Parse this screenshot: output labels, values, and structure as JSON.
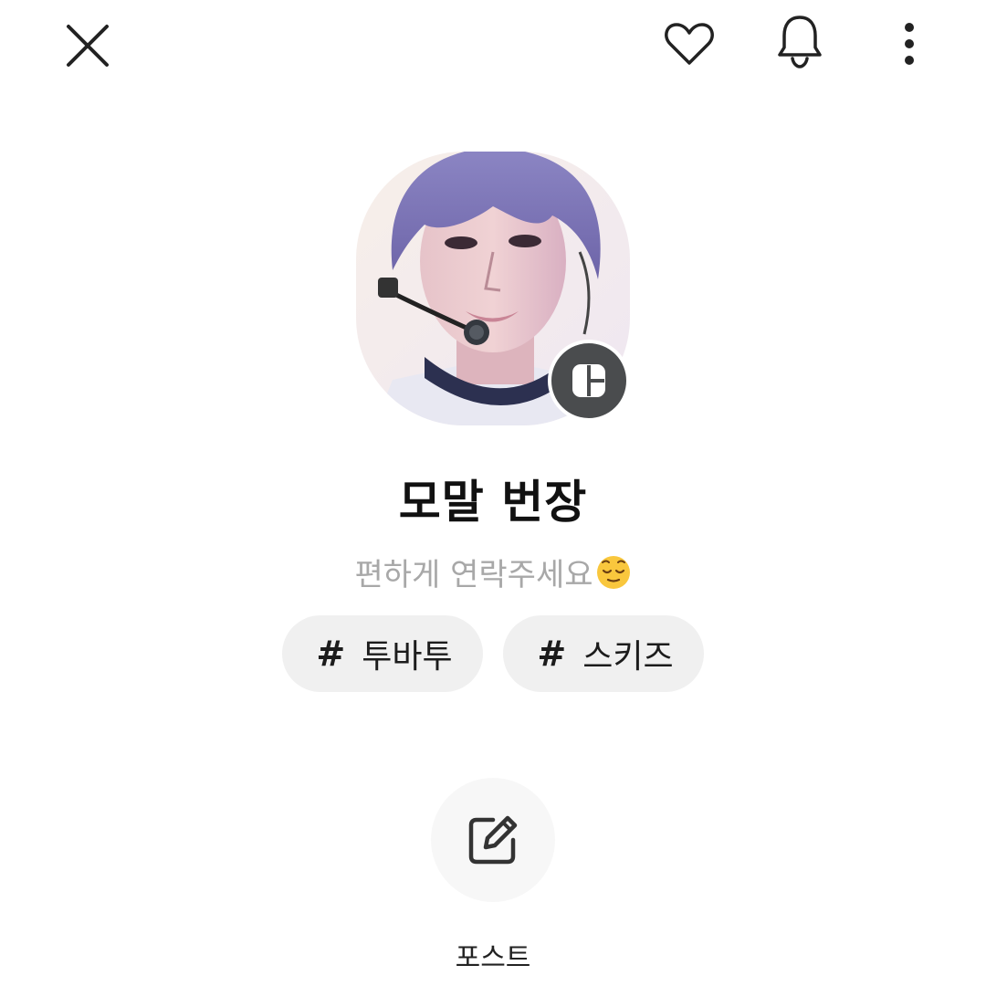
{
  "header": {
    "close_icon": "close-icon",
    "favorite_icon": "heart-icon",
    "notification_icon": "bell-icon",
    "more_icon": "more-vertical-icon"
  },
  "profile": {
    "name": "모말 번장",
    "status_message": "편하게 연락주세요",
    "status_emoji": "relieved-face-emoji",
    "badge_icon": "profile-mode-icon"
  },
  "tags": [
    {
      "hash": "#",
      "label": "투바투"
    },
    {
      "hash": "#",
      "label": "스키즈"
    }
  ],
  "actions": {
    "post_label": "포스트",
    "post_icon": "edit-icon"
  },
  "colors": {
    "background": "#ffffff",
    "chip": "#f0f0f0",
    "badge": "#4a4c4e",
    "status_text": "#a8a8a8"
  }
}
